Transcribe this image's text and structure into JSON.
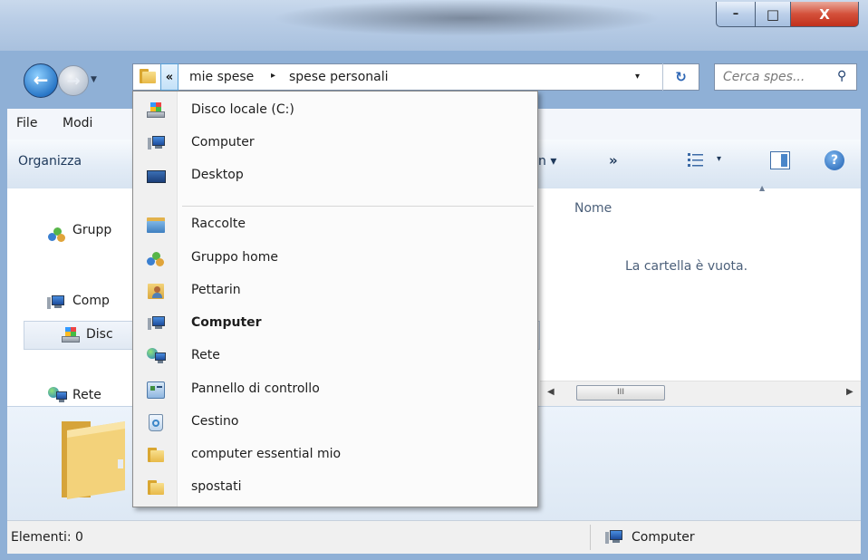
{
  "window": {
    "controls": {
      "minimize": "–",
      "maximize": "□",
      "close": "X"
    }
  },
  "navigation": {
    "back_icon": "arrow-left",
    "forward_icon": "arrow-right",
    "address": {
      "chevron": "«",
      "crumbs": [
        "mie spese",
        "spese personali"
      ],
      "separator": "▸",
      "dropdown_arrow": "▾",
      "refresh_glyph": "↻"
    },
    "search": {
      "placeholder": "Cerca spes...",
      "icon_glyph": "⚲"
    }
  },
  "menubar": {
    "items": [
      "File",
      "Modi"
    ]
  },
  "commandbar": {
    "organizza": "Organizza",
    "partial_button": "n ▾",
    "more": "»",
    "view_dropdown": "▾",
    "help": "?"
  },
  "navpane": {
    "items": [
      {
        "label": "Grupp",
        "icon": "homegroup-icon"
      },
      {
        "label": "Comp",
        "icon": "computer-icon"
      },
      {
        "label": "Disc",
        "icon": "local-disk-icon"
      },
      {
        "label": "Rete",
        "icon": "network-icon"
      }
    ]
  },
  "filepane": {
    "column_name": "Nome",
    "empty_message": "La cartella è vuota.",
    "scroll_thumb": "III"
  },
  "dropdown": {
    "items": [
      {
        "label": "Disco locale (C:)",
        "icon": "local-disk-icon",
        "bold": false
      },
      {
        "label": "Computer",
        "icon": "computer-icon",
        "bold": false
      },
      {
        "label": "Desktop",
        "icon": "desktop-icon",
        "bold": false
      },
      {
        "label": "Raccolte",
        "icon": "libraries-icon",
        "bold": false
      },
      {
        "label": "Gruppo home",
        "icon": "homegroup-icon",
        "bold": false
      },
      {
        "label": "Pettarin",
        "icon": "user-folder-icon",
        "bold": false
      },
      {
        "label": "Computer",
        "icon": "computer-icon",
        "bold": true
      },
      {
        "label": "Rete",
        "icon": "network-icon",
        "bold": false
      },
      {
        "label": "Pannello di controllo",
        "icon": "control-panel-icon",
        "bold": false
      },
      {
        "label": "Cestino",
        "icon": "recycle-bin-icon",
        "bold": false
      },
      {
        "label": "computer essential mio",
        "icon": "folder-icon",
        "bold": false
      },
      {
        "label": "spostati",
        "icon": "folder-icon",
        "bold": false
      }
    ]
  },
  "statusbar": {
    "count": "Elementi: 0",
    "location": "Computer"
  }
}
